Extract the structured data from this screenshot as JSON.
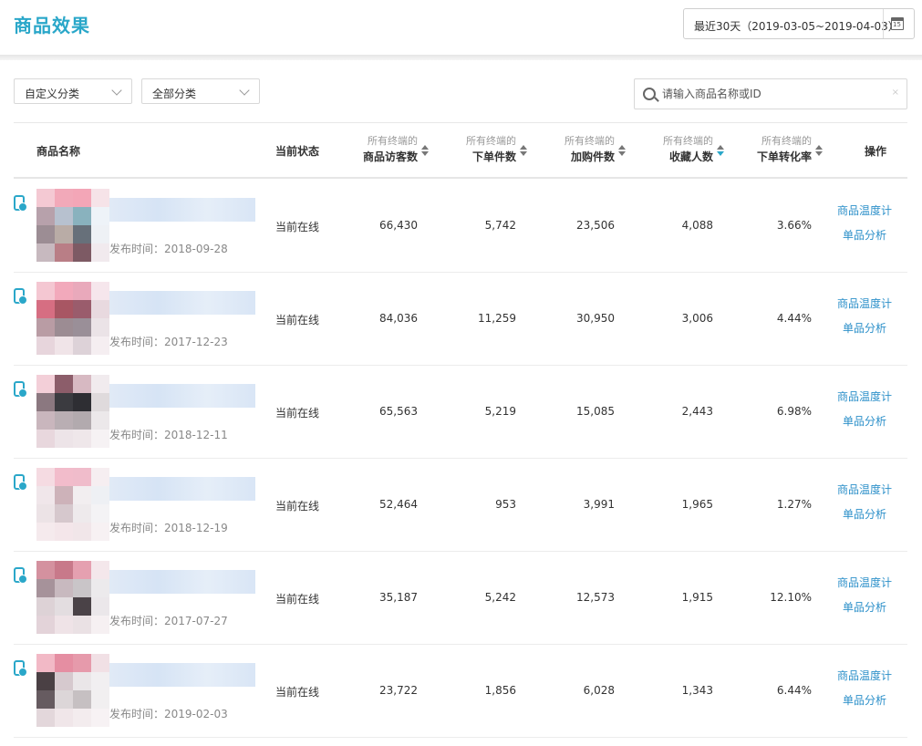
{
  "header": {
    "title": "商品效果",
    "date_range": "最近30天（2019-03-05~2019-04-03）",
    "calendar_day": "15"
  },
  "filters": {
    "custom_category": "自定义分类",
    "all_category": "全部分类",
    "search_placeholder": "请输入商品名称或ID",
    "clear_glyph": "×"
  },
  "table": {
    "col_name": "商品名称",
    "col_status": "当前状态",
    "col_ops": "操作",
    "metric_prefix": "所有终端的",
    "col_visitors": "商品访客数",
    "col_orders": "下单件数",
    "col_cart": "加购件数",
    "col_fav": "收藏人数",
    "col_conv": "下单转化率",
    "active_sort": "收藏人数",
    "op_temp": "商品温度计",
    "op_analysis": "单品分析",
    "rows": [
      {
        "publish": "发布时间：2018-09-28",
        "status": "当前在线",
        "visitors": "66,430",
        "orders": "5,742",
        "cart": "23,506",
        "fav": "4,088",
        "conv": "3.66%"
      },
      {
        "publish": "发布时间：2017-12-23",
        "status": "当前在线",
        "visitors": "84,036",
        "orders": "11,259",
        "cart": "30,950",
        "fav": "3,006",
        "conv": "4.44%"
      },
      {
        "publish": "发布时间：2018-12-11",
        "status": "当前在线",
        "visitors": "65,563",
        "orders": "5,219",
        "cart": "15,085",
        "fav": "2,443",
        "conv": "6.98%"
      },
      {
        "publish": "发布时间：2018-12-19",
        "status": "当前在线",
        "visitors": "52,464",
        "orders": "953",
        "cart": "3,991",
        "fav": "1,965",
        "conv": "1.27%"
      },
      {
        "publish": "发布时间：2017-07-27",
        "status": "当前在线",
        "visitors": "35,187",
        "orders": "5,242",
        "cart": "12,573",
        "fav": "1,915",
        "conv": "12.10%"
      },
      {
        "publish": "发布时间：2019-02-03",
        "status": "当前在线",
        "visitors": "23,722",
        "orders": "1,856",
        "cart": "6,028",
        "fav": "1,343",
        "conv": "6.44%"
      }
    ]
  },
  "colors": {
    "accent": "#2aa7c9",
    "link": "#2b8fc9",
    "thumbs": [
      [
        "#f4c9d3",
        "#f2a9b9",
        "#f3a6b7",
        "#f6e3e8",
        "#b7a1ab",
        "#b7c1cf",
        "#89b2be",
        "#eef3f8",
        "#9c8d94",
        "#b9aca6",
        "#67707a",
        "#eef1f5",
        "#c7b9bf",
        "#b97e86",
        "#7d5a64",
        "#f1eaee"
      ],
      [
        "#f4c7d2",
        "#f2a9bb",
        "#e9a9bb",
        "#f6e6ec",
        "#d66e82",
        "#a85663",
        "#9a5c6c",
        "#e8d9df",
        "#b99ca4",
        "#9c8c93",
        "#9a8f98",
        "#ebe3e7",
        "#e7d5dc",
        "#f0e4e8",
        "#ddd2d8",
        "#f5eef1"
      ],
      [
        "#f3cfd8",
        "#8c5d6a",
        "#d7b9c2",
        "#f1ebee",
        "#8b7880",
        "#3b3b40",
        "#2e2e33",
        "#dfdadc",
        "#c9b6bd",
        "#b9aeb3",
        "#b2aaae",
        "#ece8ea",
        "#e8d7dd",
        "#ede4e8",
        "#efe7ea",
        "#f6f2f4"
      ],
      [
        "#f5dbe2",
        "#f2bccb",
        "#f0bccb",
        "#f6eef1",
        "#f0e6ea",
        "#cdb2b9",
        "#f2eef0",
        "#eef0f4",
        "#ece3e6",
        "#d6c8cd",
        "#eeeaec",
        "#f4f3f5",
        "#f5eaed",
        "#f4e6ea",
        "#f1e6e9",
        "#f7f1f3"
      ],
      [
        "#d4919f",
        "#c8798a",
        "#e5a0b0",
        "#f4e7eb",
        "#a6929a",
        "#c8b9bf",
        "#c9c5c8",
        "#eceaec",
        "#ddd2d6",
        "#e3dde0",
        "#4a4247",
        "#ebe7ea",
        "#e3d3d9",
        "#efe3e7",
        "#eae1e4",
        "#f6f0f2"
      ],
      [
        "#f2b9c6",
        "#e58ea2",
        "#e69aab",
        "#f1e0e5",
        "#4a4044",
        "#d6c9ce",
        "#eae6e8",
        "#f1eff1",
        "#665b60",
        "#dcd6d8",
        "#c6c0c2",
        "#f1eff0",
        "#e3d7db",
        "#f0e6e9",
        "#f3ecee",
        "#f7f2f4"
      ]
    ]
  }
}
